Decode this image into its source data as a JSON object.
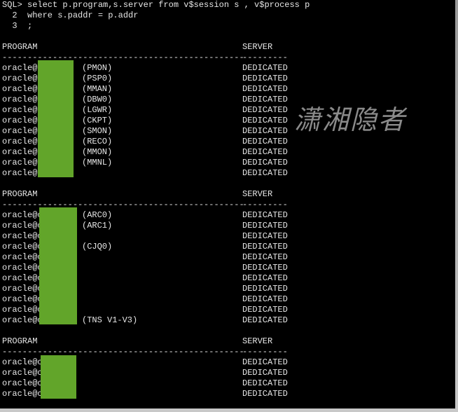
{
  "query_lines": [
    "SQL> select p.program,s.server from v$session s , v$process p",
    "  2  where s.paddr = p.addr",
    "  3  ;"
  ],
  "header": {
    "program": "PROGRAM",
    "server": "SERVER",
    "program_rule": "------------------------------------------------",
    "server_rule": "---------"
  },
  "blocks": [
    {
      "rows": [
        {
          "program": "oracle@",
          "suffix": "(PMON)",
          "server": "DEDICATED"
        },
        {
          "program": "oracle@",
          "suffix": "(PSP0)",
          "server": "DEDICATED"
        },
        {
          "program": "oracle@",
          "suffix": "(MMAN)",
          "server": "DEDICATED"
        },
        {
          "program": "oracle@",
          "suffix": "(DBW0)",
          "server": "DEDICATED"
        },
        {
          "program": "oracle@",
          "suffix": "(LGWR)",
          "server": "DEDICATED"
        },
        {
          "program": "oracle@",
          "suffix": "(CKPT)",
          "server": "DEDICATED"
        },
        {
          "program": "oracle@",
          "suffix": "(SMON)",
          "server": "DEDICATED"
        },
        {
          "program": "oracle@",
          "suffix": "(RECO)",
          "server": "DEDICATED"
        },
        {
          "program": "oracle@",
          "suffix": "(MMON)",
          "server": "DEDICATED"
        },
        {
          "program": "oracle@",
          "suffix": "(MMNL)",
          "server": "DEDICATED"
        },
        {
          "program": "oracle@",
          "suffix": "",
          "server": "DEDICATED"
        }
      ]
    },
    {
      "rows": [
        {
          "program": "oracle@c",
          "suffix": "(ARC0)",
          "server": "DEDICATED"
        },
        {
          "program": "oracle@c",
          "suffix": "(ARC1)",
          "server": "DEDICATED"
        },
        {
          "program": "oracle@c",
          "suffix": "",
          "server": "DEDICATED"
        },
        {
          "program": "oracle@c",
          "suffix": "(CJQ0)",
          "server": "DEDICATED"
        },
        {
          "program": "oracle@c",
          "suffix": "",
          "server": "DEDICATED"
        },
        {
          "program": "oracle@c",
          "suffix": "",
          "server": "DEDICATED"
        },
        {
          "program": "oracle@c",
          "suffix": "",
          "server": "DEDICATED"
        },
        {
          "program": "oracle@c",
          "suffix": "",
          "server": "DEDICATED"
        },
        {
          "program": "oracle@c",
          "suffix": "",
          "server": "DEDICATED"
        },
        {
          "program": "oracle@c",
          "suffix": "",
          "server": "DEDICATED"
        },
        {
          "program": "oracle@c",
          "suffix": "(TNS V1-V3)",
          "server": "DEDICATED"
        }
      ]
    },
    {
      "rows": [
        {
          "program": "oracle@c",
          "suffix": "",
          "server": "DEDICATED"
        },
        {
          "program": "oracle@c",
          "suffix": "",
          "server": "DEDICATED"
        },
        {
          "program": "oracle@c",
          "suffix": "",
          "server": "DEDICATED"
        },
        {
          "program": "oracle@c",
          "suffix": "",
          "server": "DEDICATED"
        }
      ]
    }
  ],
  "watermark": "潇湘隐者",
  "colors": {
    "redaction": "#62a52a",
    "background": "#000000",
    "text": "#e6e6e6"
  }
}
